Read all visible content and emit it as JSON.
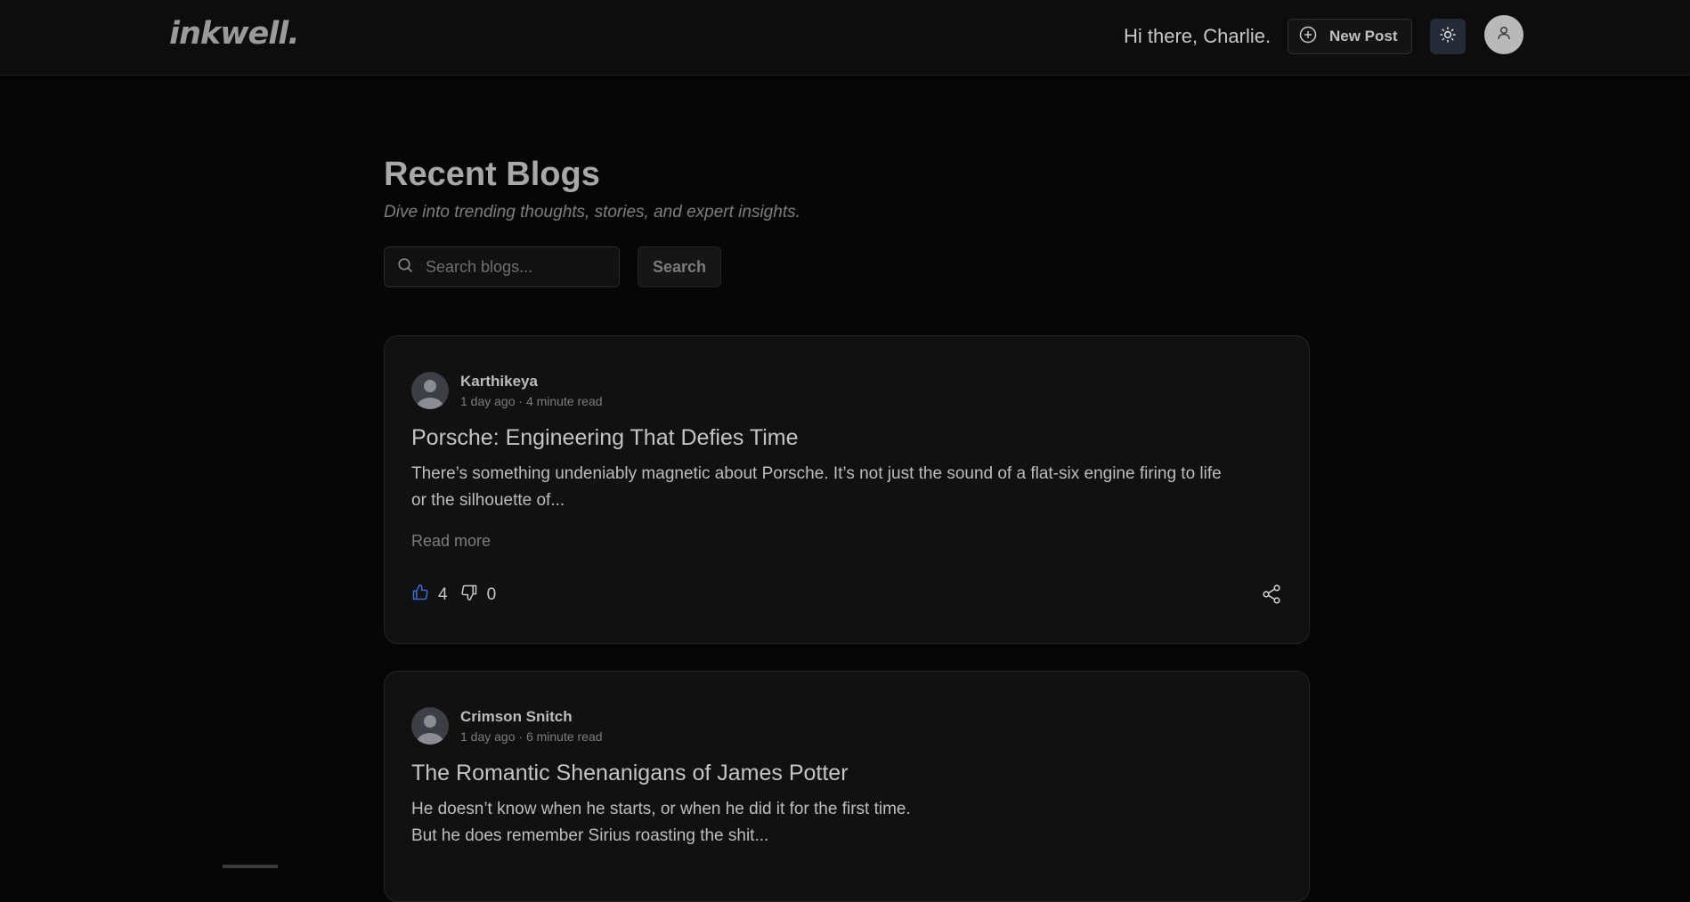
{
  "header": {
    "logo": "inkwell.",
    "greeting": "Hi there, Charlie.",
    "new_post_label": "New Post",
    "icons": {
      "new_post": "plus-circle-icon",
      "theme": "sun-icon",
      "avatar": "user-icon"
    }
  },
  "main": {
    "title": "Recent Blogs",
    "subtitle": "Dive into trending thoughts, stories, and expert insights.",
    "search": {
      "placeholder": "Search blogs...",
      "value": "",
      "button_label": "Search"
    }
  },
  "posts": [
    {
      "author": "Karthikeya",
      "meta": "1 day ago · 4 minute read",
      "title": "Porsche: Engineering That Defies Time",
      "excerpt": "There’s something undeniably magnetic about Porsche. It’s not just the sound of a flat-six engine firing to life\nor the silhouette of...",
      "read_more": "Read more",
      "likes": "4",
      "dislikes": "0"
    },
    {
      "author": "Crimson Snitch",
      "meta": "1 day ago · 6 minute read",
      "title": "The Romantic Shenanigans of James Potter",
      "excerpt": "He doesn’t know when he starts, or when he did it for the first time.\nBut he does remember Sirius roasting the shit..."
    }
  ],
  "colors": {
    "background": "#060606",
    "card": "#111111",
    "like_accent": "#3b6fd6",
    "theme_button": "#252b36"
  }
}
